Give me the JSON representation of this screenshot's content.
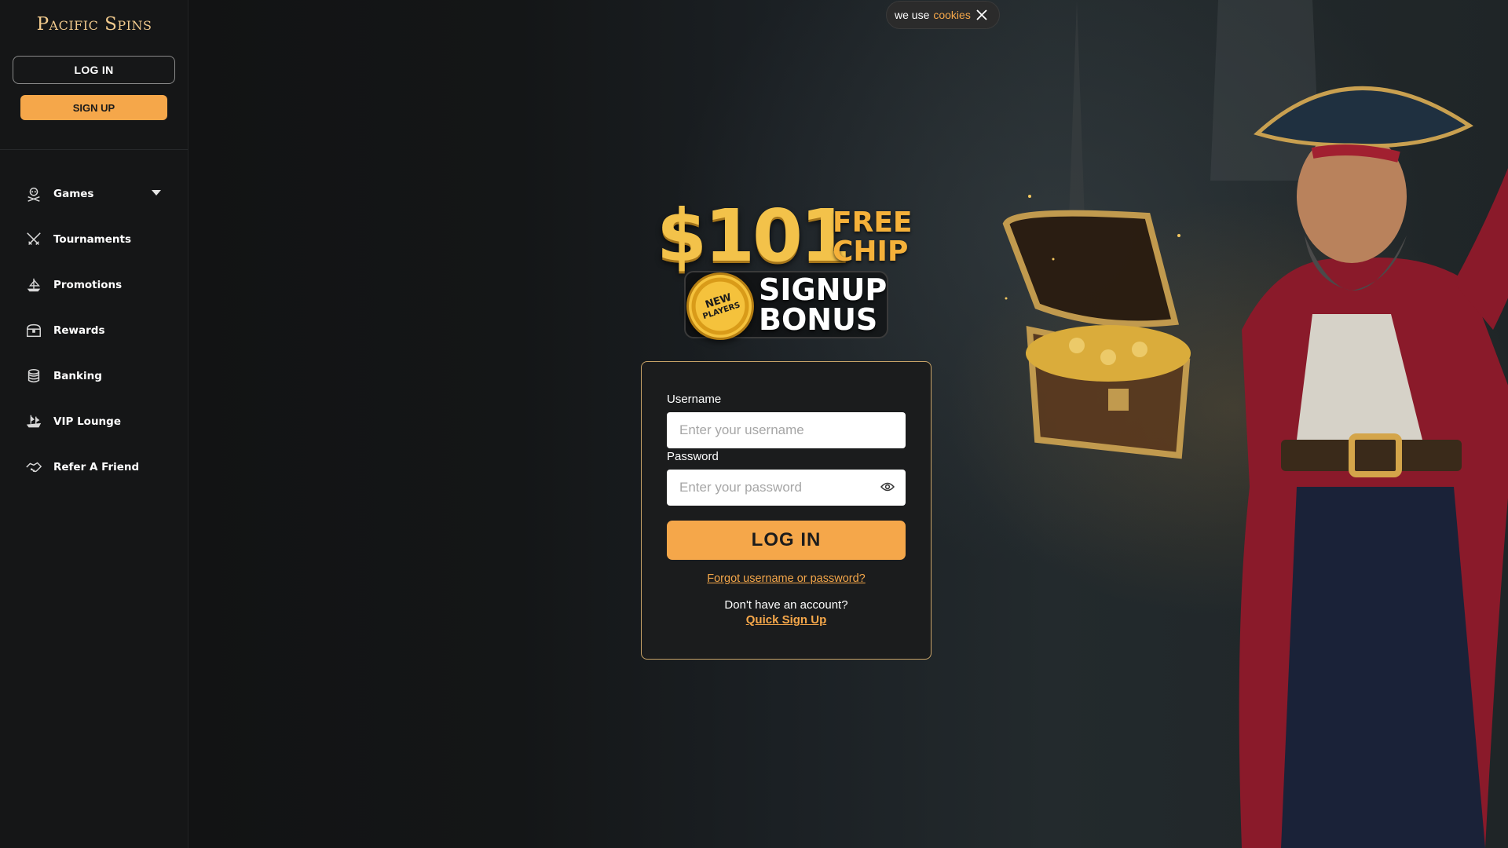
{
  "brand": {
    "logo_text": "Pacific Spins"
  },
  "sidebar": {
    "login_label": "LOG IN",
    "signup_label": "SIGN UP",
    "items": [
      {
        "label": "Games",
        "icon": "skull-crossbones-icon",
        "has_dropdown": true
      },
      {
        "label": "Tournaments",
        "icon": "crossed-swords-icon"
      },
      {
        "label": "Promotions",
        "icon": "ship-icon"
      },
      {
        "label": "Rewards",
        "icon": "treasure-chest-icon"
      },
      {
        "label": "Banking",
        "icon": "coins-stack-icon"
      },
      {
        "label": "VIP Lounge",
        "icon": "pirate-ship-icon"
      },
      {
        "label": "Refer A Friend",
        "icon": "handshake-icon"
      }
    ]
  },
  "cookie_banner": {
    "text": "we use",
    "link": "cookies"
  },
  "promo": {
    "amount": "$101",
    "free_line1": "FREE",
    "free_line2": "CHIP",
    "chip_line1": "NEW",
    "chip_line2": "PLAYERS",
    "bonus_line1": "SIGNUP",
    "bonus_line2": "BONUS"
  },
  "login_form": {
    "username_label": "Username",
    "username_placeholder": "Enter your username",
    "password_label": "Password",
    "password_placeholder": "Enter your password",
    "submit_label": "LOG IN",
    "forgot_label": "Forgot username or password?",
    "no_account_text": "Don't have an account?",
    "signup_link": "Quick Sign Up"
  },
  "colors": {
    "accent": "#f5a74a",
    "sidebar_bg": "#151617",
    "card_border": "#c9a468",
    "chat_button": "#1f6fe0"
  }
}
